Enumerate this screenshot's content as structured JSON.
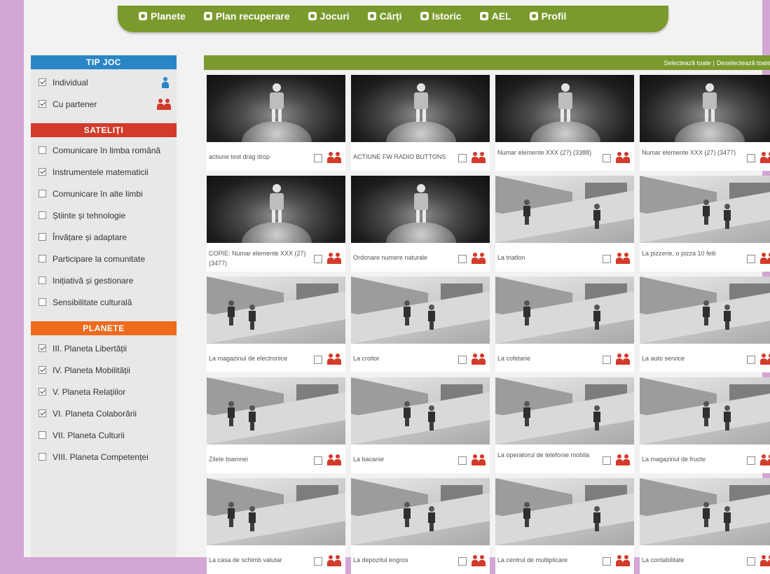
{
  "nav": [
    {
      "label": "Planete",
      "icon": "planet-icon"
    },
    {
      "label": "Plan recuperare",
      "icon": "plan-icon"
    },
    {
      "label": "Jocuri",
      "icon": "games-icon"
    },
    {
      "label": "Cărți",
      "icon": "book-icon"
    },
    {
      "label": "Istoric",
      "icon": "history-icon"
    },
    {
      "label": "AEL",
      "icon": "ael-icon"
    },
    {
      "label": "Profil",
      "icon": "profile-icon"
    }
  ],
  "sidebar": {
    "tip_joc": {
      "title": "TIP JOC",
      "items": [
        {
          "label": "Individual",
          "checked": true,
          "icon": "single-player-icon"
        },
        {
          "label": "Cu partener",
          "checked": true,
          "icon": "partner-icon"
        }
      ]
    },
    "sateliti": {
      "title": "SATELIȚI",
      "items": [
        {
          "label": "Comunicare în limba română",
          "checked": false
        },
        {
          "label": "Instrumentele matematicii",
          "checked": true
        },
        {
          "label": "Comunicare în alte limbi",
          "checked": false
        },
        {
          "label": "Știinte și tehnologie",
          "checked": false
        },
        {
          "label": "Învățare și adaptare",
          "checked": false
        },
        {
          "label": "Participare la comunitate",
          "checked": false
        },
        {
          "label": "Inițiativă și gestionare",
          "checked": false
        },
        {
          "label": "Sensibilitate culturală",
          "checked": false
        }
      ]
    },
    "planete": {
      "title": "PLANETE",
      "items": [
        {
          "label": "III. Planeta Libertății",
          "checked": true
        },
        {
          "label": "IV. Planeta Mobilității",
          "checked": true
        },
        {
          "label": "V. Planeta Relațiilor",
          "checked": true
        },
        {
          "label": "VI. Planeta Colaborării",
          "checked": true
        },
        {
          "label": "VII. Planeta Culturii",
          "checked": false
        },
        {
          "label": "VIII. Planeta Competenței",
          "checked": false
        }
      ]
    }
  },
  "main": {
    "select_all": "Selectează toate",
    "separator": "|",
    "deselect_all": "Deselectează toate",
    "games": [
      {
        "title": "actiune test drag drop",
        "thumb": "space"
      },
      {
        "title": "ACTIUNE FW RADIO BUTTONS",
        "thumb": "space"
      },
      {
        "title": "Numar elemente XXX (27) (3388)",
        "thumb": "space"
      },
      {
        "title": "Numar elemente XXX (27) (3477)",
        "thumb": "space"
      },
      {
        "title": "COPIE: Numar elemente XXX (27) (3477)",
        "thumb": "space"
      },
      {
        "title": "Ordonare numere naturale",
        "thumb": "space"
      },
      {
        "title": "La triatlon",
        "thumb": "scene"
      },
      {
        "title": "La pizzerie, o pizza 10 felii",
        "thumb": "scene"
      },
      {
        "title": "La magazinul de electronice",
        "thumb": "scene"
      },
      {
        "title": "La croitor",
        "thumb": "scene"
      },
      {
        "title": "La cofetarie",
        "thumb": "scene"
      },
      {
        "title": "La auto service",
        "thumb": "scene"
      },
      {
        "title": "Zilele toamnei",
        "thumb": "scene"
      },
      {
        "title": "La bacanie",
        "thumb": "scene"
      },
      {
        "title": "La operatorul de telefonie mobila",
        "thumb": "scene"
      },
      {
        "title": "La magazinul de fructe",
        "thumb": "scene"
      },
      {
        "title": "La casa de schimb valutar",
        "thumb": "scene"
      },
      {
        "title": "La depozitul engros",
        "thumb": "scene"
      },
      {
        "title": "La centrul de multiplicare",
        "thumb": "scene"
      },
      {
        "title": "La contabilitate",
        "thumb": "scene"
      }
    ]
  },
  "colors": {
    "nav_green": "#7a9a2d",
    "tip_joc_blue": "#2a85c7",
    "sateliti_red": "#d23a2a",
    "planete_orange": "#ee6b1e",
    "background_purple": "#d3a6d3"
  }
}
